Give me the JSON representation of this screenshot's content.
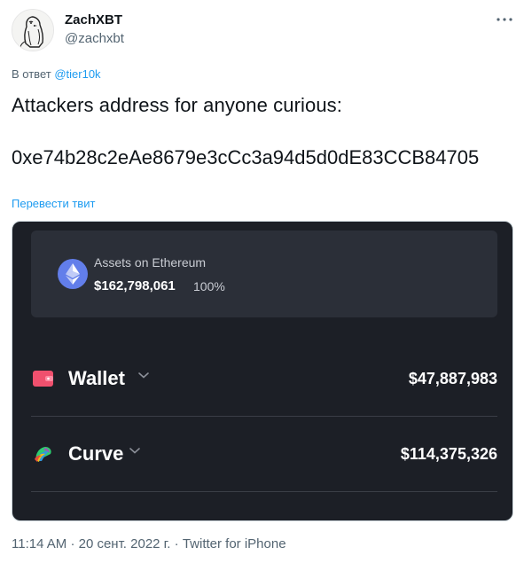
{
  "author": {
    "display_name": "ZachXBT",
    "handle": "@zachxbt"
  },
  "icons": {
    "avatar": "penguin-sketch-avatar",
    "more": "more-dots-icon",
    "ethereum": "ethereum-icon",
    "wallet": "wallet-icon",
    "curve": "curve-logo-icon",
    "chevron": "chevron-down-icon"
  },
  "reply": {
    "prefix": "В ответ",
    "to": "@tier10k"
  },
  "tweet": {
    "line1": "Attackers address for anyone curious:",
    "address": "0xe74b28c2eAe8679e3cCc3a94d5d0dE83CCB84705",
    "translate": "Перевести твит"
  },
  "card": {
    "assets_title": "Assets on Ethereum",
    "assets_value": "$162,798,061",
    "assets_pct": "100%",
    "rows": [
      {
        "label": "Wallet",
        "value": "$47,887,983"
      },
      {
        "label": "Curve",
        "value": "$114,375,326"
      }
    ]
  },
  "footer": {
    "time": "11:14 AM",
    "date": "20 сент. 2022 г.",
    "source": "Twitter for iPhone",
    "sep": "·"
  },
  "colors": {
    "link": "#1d9bf0",
    "card_bg": "#1c1f26",
    "ethereum": "#627eea",
    "wallet": "#f0506e"
  }
}
